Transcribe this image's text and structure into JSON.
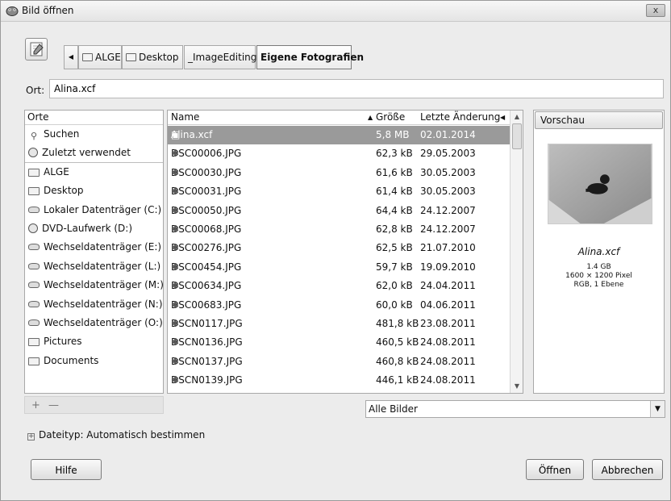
{
  "window": {
    "title": "Bild öffnen",
    "close_label": "x"
  },
  "pathbar": {
    "crumbs": [
      "ALGE",
      "Desktop",
      "_ImageEditing",
      "Eigene Fotografien"
    ],
    "active_crumb": "Eigene Fotografien"
  },
  "location": {
    "label": "Ort:",
    "value": "Alina.xcf"
  },
  "places": {
    "header": "Orte",
    "items": [
      {
        "label": "Suchen",
        "icon": "search-icon"
      },
      {
        "label": "Zuletzt verwendet",
        "icon": "recent-icon"
      },
      {
        "label": "ALGE",
        "icon": "folder-icon"
      },
      {
        "label": "Desktop",
        "icon": "folder-icon"
      },
      {
        "label": "Lokaler Datenträger (C:)",
        "icon": "drive-icon"
      },
      {
        "label": "DVD-Laufwerk (D:)",
        "icon": "disc-icon"
      },
      {
        "label": "Wechseldatenträger (E:)",
        "icon": "removable-drive-icon"
      },
      {
        "label": "Wechseldatenträger (L:)",
        "icon": "removable-drive-icon"
      },
      {
        "label": "Wechseldatenträger (M:)",
        "icon": "removable-drive-icon"
      },
      {
        "label": "Wechseldatenträger (N:)",
        "icon": "removable-drive-icon"
      },
      {
        "label": "Wechseldatenträger (O:)",
        "icon": "removable-drive-icon"
      },
      {
        "label": "Pictures",
        "icon": "folder-icon"
      },
      {
        "label": "Documents",
        "icon": "folder-icon"
      }
    ],
    "add_label": "+",
    "remove_label": "—"
  },
  "files": {
    "columns": {
      "name": "Name",
      "size": "Größe",
      "modified": "Letzte Änderung"
    },
    "rows": [
      {
        "name": "Alina.xcf",
        "size": "5,8 MB",
        "date": "02.01.2014",
        "selected": true
      },
      {
        "name": "DSC00006.JPG",
        "size": "62,3 kB",
        "date": "29.05.2003"
      },
      {
        "name": "DSC00030.JPG",
        "size": "61,6 kB",
        "date": "30.05.2003"
      },
      {
        "name": "DSC00031.JPG",
        "size": "61,4 kB",
        "date": "30.05.2003"
      },
      {
        "name": "DSC00050.JPG",
        "size": "64,4 kB",
        "date": "24.12.2007"
      },
      {
        "name": "DSC00068.JPG",
        "size": "62,8 kB",
        "date": "24.12.2007"
      },
      {
        "name": "DSC00276.JPG",
        "size": "62,5 kB",
        "date": "21.07.2010"
      },
      {
        "name": "DSC00454.JPG",
        "size": "59,7 kB",
        "date": "19.09.2010"
      },
      {
        "name": "DSC00634.JPG",
        "size": "62,0 kB",
        "date": "24.04.2011"
      },
      {
        "name": "DSC00683.JPG",
        "size": "60,0 kB",
        "date": "04.06.2011"
      },
      {
        "name": "DSCN0117.JPG",
        "size": "481,8 kB",
        "date": "23.08.2011"
      },
      {
        "name": "DSCN0136.JPG",
        "size": "460,5 kB",
        "date": "24.08.2011"
      },
      {
        "name": "DSCN0137.JPG",
        "size": "460,8 kB",
        "date": "24.08.2011"
      },
      {
        "name": "DSCN0139.JPG",
        "size": "446,1 kB",
        "date": "24.08.2011"
      }
    ]
  },
  "preview": {
    "button_label": "Vorschau",
    "filename": "Alina.xcf",
    "info_lines": [
      "1.4 GB",
      "1600 × 1200 Pixel",
      "RGB, 1 Ebene"
    ]
  },
  "filter": {
    "selected": "Alle Bilder"
  },
  "filetype": {
    "label": "Dateityp: Automatisch bestimmen"
  },
  "buttons": {
    "help": "Hilfe",
    "open": "Öffnen",
    "cancel": "Abbrechen"
  }
}
